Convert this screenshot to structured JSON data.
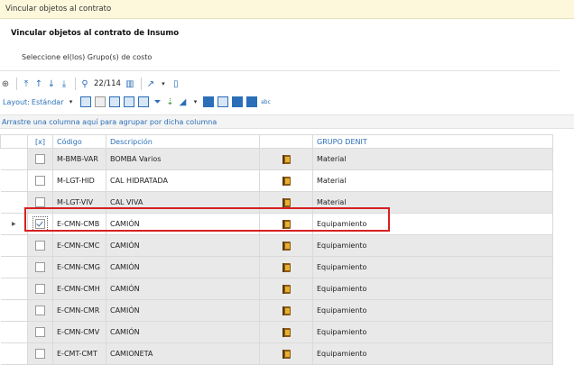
{
  "window": {
    "title": "Vincular objetos al contrato"
  },
  "dialog": {
    "subtitle": "Vincular objetos al contrato de Insumo",
    "instruction": "Seleccione el(los) Grupo(s) de costo"
  },
  "toolbar": {
    "counter": "22/114",
    "layout_label": "Layout:",
    "layout_value": "Estándar",
    "group_hint": "Arrastre una columna aquí para agrupar por dicha columna"
  },
  "grid": {
    "columns": [
      "[x]",
      "Código",
      "Descripción",
      "",
      "GRUPO DENIT"
    ],
    "rows": [
      {
        "code": "M-BMB-VAR",
        "desc": "BOMBA Varios",
        "group": "Material",
        "checked": false
      },
      {
        "code": "M-LGT-HID",
        "desc": "CAL HIDRATADA",
        "group": "Material",
        "checked": false
      },
      {
        "code": "M-LGT-VIV",
        "desc": "CAL VIVA",
        "group": "Material",
        "checked": false
      },
      {
        "code": "E-CMN-CMB",
        "desc": "CAMIÓN",
        "group": "Equipamiento",
        "checked": true
      },
      {
        "code": "E-CMN-CMC",
        "desc": "CAMIÓN",
        "group": "Equipamiento",
        "checked": false
      },
      {
        "code": "E-CMN-CMG",
        "desc": "CAMIÓN",
        "group": "Equipamiento",
        "checked": false
      },
      {
        "code": "E-CMN-CMH",
        "desc": "CAMIÓN",
        "group": "Equipamiento",
        "checked": false
      },
      {
        "code": "E-CMN-CMR",
        "desc": "CAMIÓN",
        "group": "Equipamiento",
        "checked": false
      },
      {
        "code": "E-CMN-CMV",
        "desc": "CAMIÓN",
        "group": "Equipamiento",
        "checked": false
      },
      {
        "code": "E-CMT-CMT",
        "desc": "CAMIONETA",
        "group": "Equipamiento",
        "checked": false
      }
    ],
    "current_row": 3,
    "highlight_color": "#d82020"
  }
}
